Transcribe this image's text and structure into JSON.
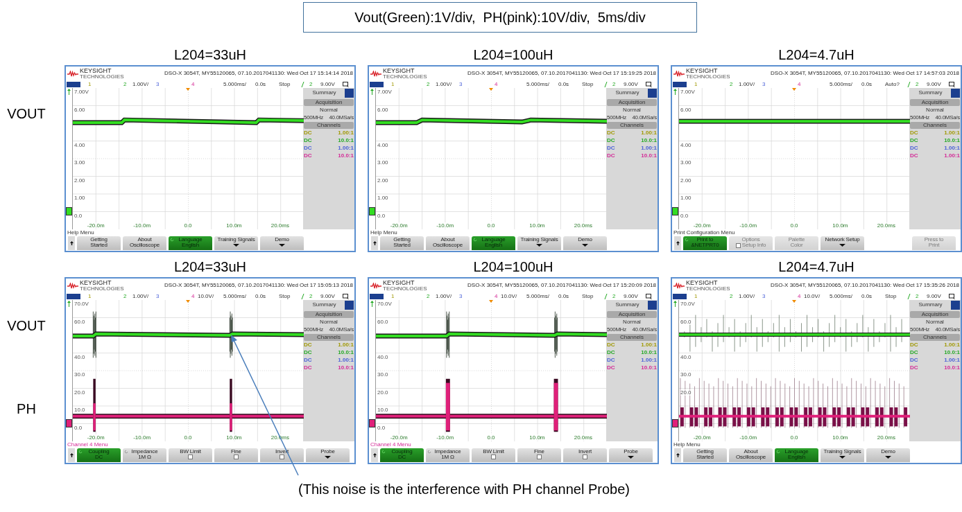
{
  "header": "Vout(Green):1V/div,  PH(pink):10V/div,  5ms/div",
  "rows": [
    {
      "labels": [
        {
          "text": "VOUT",
          "kind": "vout"
        }
      ],
      "panels": [
        {
          "title": "L204=33uH",
          "scope": {
            "brand": "KEYSIGHT",
            "brand_sub": "TECHNOLOGIES",
            "info": "DSO-X 3054T, MY55120065, 07.10.2017041130: Wed Oct 17 15:14:14 2018",
            "status": {
              "ch1": "1",
              "ch2": "2",
              "ch2_scale": "1.00V/",
              "ch3": "3",
              "ch4": "4",
              "timebase": "5.000ms/",
              "delay": "0.0s",
              "run": "Stop",
              "trig_source": "2",
              "trig_level": "9.00V"
            },
            "y_labels": [
              "7.00V",
              "6.00",
              "4.00",
              "3.00",
              "2.00",
              "1.00",
              "0.0"
            ],
            "x_labels": [
              "-20.0m",
              "-10.0m",
              "0.0",
              "10.0m",
              "20.0ms"
            ],
            "traces": [
              {
                "kind": "steps",
                "color": "#33dd22",
                "ground_marker": true
              }
            ],
            "side": {
              "tab": "Summary",
              "acq": "Acquisition",
              "mode": "Normal",
              "bw": "500MHz",
              "rate": "40.0MSa/s",
              "channels_title": "Channels",
              "channels": [
                {
                  "coupling": "DC",
                  "probe": "1.00:1",
                  "color": "#a09800"
                },
                {
                  "coupling": "DC",
                  "probe": "10.0:1",
                  "color": "#22a822"
                },
                {
                  "coupling": "DC",
                  "probe": "1.00:1",
                  "color": "#4a60d8"
                },
                {
                  "coupling": "DC",
                  "probe": "10.0:1",
                  "color": "#d42896"
                }
              ]
            },
            "menu": {
              "title": "Help Menu",
              "kind": "general"
            },
            "softkeys": [
              {
                "kind": "normal",
                "lines": [
                  "Getting",
                  "Started"
                ]
              },
              {
                "kind": "normal",
                "lines": [
                  "About",
                  "Oscilloscope"
                ]
              },
              {
                "kind": "active",
                "lines": [
                  "Language",
                  "English"
                ],
                "rotary": true
              },
              {
                "kind": "normal",
                "lines": [
                  "Training Signals"
                ],
                "submenu": true
              },
              {
                "kind": "normal",
                "lines": [
                  "Demo"
                ],
                "submenu": true
              }
            ]
          }
        },
        {
          "title": "L204=100uH",
          "scope": {
            "brand": "KEYSIGHT",
            "brand_sub": "TECHNOLOGIES",
            "info": "DSO-X 3054T, MY55120065, 07.10.2017041130: Wed Oct 17 15:19:25 2018",
            "status": {
              "ch1": "1",
              "ch2": "2",
              "ch2_scale": "1.00V/",
              "ch3": "3",
              "ch4": "4",
              "timebase": "5.000ms/",
              "delay": "0.0s",
              "run": "Stop",
              "trig_source": "2",
              "trig_level": "9.00V"
            },
            "y_labels": [
              "7.00V",
              "6.00",
              "4.00",
              "3.00",
              "2.00",
              "1.00",
              "0.0"
            ],
            "x_labels": [
              "-20.0m",
              "-10.0m",
              "0.0",
              "10.0m",
              "20.0ms"
            ],
            "traces": [
              {
                "kind": "ramps",
                "color": "#33dd22",
                "ground_marker": true
              }
            ],
            "side": {
              "tab": "Summary",
              "acq": "Acquisition",
              "mode": "Normal",
              "bw": "500MHz",
              "rate": "40.0MSa/s",
              "channels_title": "Channels",
              "channels": [
                {
                  "coupling": "DC",
                  "probe": "1.00:1",
                  "color": "#a09800"
                },
                {
                  "coupling": "DC",
                  "probe": "10.0:1",
                  "color": "#22a822"
                },
                {
                  "coupling": "DC",
                  "probe": "1.00:1",
                  "color": "#4a60d8"
                },
                {
                  "coupling": "DC",
                  "probe": "10.0:1",
                  "color": "#d42896"
                }
              ]
            },
            "menu": {
              "title": "Help Menu",
              "kind": "general"
            },
            "softkeys": [
              {
                "kind": "normal",
                "lines": [
                  "Getting",
                  "Started"
                ]
              },
              {
                "kind": "normal",
                "lines": [
                  "About",
                  "Oscilloscope"
                ]
              },
              {
                "kind": "active",
                "lines": [
                  "Language",
                  "English"
                ],
                "rotary": true
              },
              {
                "kind": "normal",
                "lines": [
                  "Training Signals"
                ],
                "submenu": true
              },
              {
                "kind": "normal",
                "lines": [
                  "Demo"
                ],
                "submenu": true
              }
            ]
          }
        },
        {
          "title": "L204=4.7uH",
          "scope": {
            "brand": "KEYSIGHT",
            "brand_sub": "TECHNOLOGIES",
            "info": "DSO-X 3054T, MY55120065, 07.10.2017041130: Wed Oct 17 14:57:03 2018",
            "status": {
              "ch1": "1",
              "ch2": "2",
              "ch2_scale": "1.00V/",
              "ch3": "3",
              "ch4": "4",
              "timebase": "5.000ms/",
              "delay": "0.0s",
              "run": "Auto?",
              "trig_source": "2",
              "trig_level": "9.00V"
            },
            "y_labels": [
              "7.00V",
              "6.00",
              "4.00",
              "3.00",
              "2.00",
              "1.00",
              "0.0"
            ],
            "x_labels": [
              "-20.0m",
              "-10.0m",
              "0.0",
              "10.0m",
              "20.0ms"
            ],
            "traces": [
              {
                "kind": "flat",
                "color": "#33dd22",
                "ground_marker": true
              }
            ],
            "side": {
              "tab": "Summary",
              "acq": "Acquisition",
              "mode": "Normal",
              "bw": "500MHz",
              "rate": "40.0MSa/s",
              "channels_title": "Channels",
              "channels": [
                {
                  "coupling": "DC",
                  "probe": "1.00:1",
                  "color": "#a09800"
                },
                {
                  "coupling": "DC",
                  "probe": "10.0:1",
                  "color": "#22a822"
                },
                {
                  "coupling": "DC",
                  "probe": "1.00:1",
                  "color": "#4a60d8"
                },
                {
                  "coupling": "DC",
                  "probe": "1.00:1",
                  "color": "#d42896"
                }
              ]
            },
            "menu": {
              "title": "Print Configuration Menu",
              "kind": "general"
            },
            "softkeys": [
              {
                "kind": "active",
                "lines": [
                  "Print to",
                  "&NETPRT0"
                ],
                "rotary": true
              },
              {
                "kind": "disabled",
                "lines": [
                  "Options"
                ],
                "checkbox": {
                  "checked": false,
                  "label": "Setup Info"
                }
              },
              {
                "kind": "disabled",
                "lines": [
                  "Palette",
                  "Color"
                ]
              },
              {
                "kind": "normal",
                "lines": [
                  "Network Setup"
                ],
                "submenu": true
              },
              {
                "kind": "empty"
              },
              {
                "kind": "disabled",
                "lines": [
                  "Press to",
                  "Print"
                ]
              }
            ]
          }
        }
      ]
    },
    {
      "labels": [
        {
          "text": "VOUT",
          "kind": "vout"
        },
        {
          "text": "PH",
          "kind": "ph"
        }
      ],
      "panels": [
        {
          "title": "L204=33uH",
          "scope": {
            "brand": "KEYSIGHT",
            "brand_sub": "TECHNOLOGIES",
            "info": "DSO-X 3054T, MY55120065, 07.10.2017041130: Wed Oct 17 15:05:13 2018",
            "status": {
              "ch1": "1",
              "ch2": "2",
              "ch2_scale": "1.00V/",
              "ch3": "3",
              "ch4": "4",
              "ch4_scale": "10.0V/",
              "timebase": "5.000ms/",
              "delay": "0.0s",
              "run": "Stop",
              "trig_source": "2",
              "trig_level": "9.00V"
            },
            "y_labels": [
              "70.0V",
              "60.0",
              "40.0",
              "30.0",
              "20.0",
              "10.0",
              "0.0"
            ],
            "x_labels": [
              "-20.0m",
              "-10.0m",
              "0.0",
              "10.0m",
              "20.0ms"
            ],
            "traces": [
              {
                "kind": "bursts_wide",
                "color": "#33dd22",
                "ground_marker": false
              },
              {
                "kind": "pulses_wide",
                "color": "#e0207a",
                "ground_marker": true
              }
            ],
            "side": {
              "tab": "Summary",
              "acq": "Acquisition",
              "mode": "Normal",
              "bw": "500MHz",
              "rate": "40.0MSa/s",
              "channels_title": "Channels",
              "channels": [
                {
                  "coupling": "DC",
                  "probe": "1.00:1",
                  "color": "#a09800"
                },
                {
                  "coupling": "DC",
                  "probe": "10.0:1",
                  "color": "#22a822"
                },
                {
                  "coupling": "DC",
                  "probe": "1.00:1",
                  "color": "#4a60d8"
                },
                {
                  "coupling": "DC",
                  "probe": "10.0:1",
                  "color": "#d42896"
                }
              ]
            },
            "menu": {
              "title": "Channel 4 Menu",
              "kind": "channel"
            },
            "softkeys": [
              {
                "kind": "active",
                "lines": [
                  "Coupling",
                  "DC"
                ],
                "rotary": true
              },
              {
                "kind": "normal",
                "lines": [
                  "Impedance",
                  "1M Ω"
                ],
                "rotary": true
              },
              {
                "kind": "normal",
                "lines": [
                  "BW Limit"
                ],
                "checkbox": {
                  "checked": false
                }
              },
              {
                "kind": "normal",
                "lines": [
                  "Fine"
                ],
                "checkbox": {
                  "checked": false
                }
              },
              {
                "kind": "normal",
                "lines": [
                  "Invert"
                ],
                "checkbox": {
                  "checked": false
                }
              },
              {
                "kind": "normal",
                "lines": [
                  "Probe"
                ],
                "submenu": true
              }
            ]
          }
        },
        {
          "title": "L204=100uH",
          "scope": {
            "brand": "KEYSIGHT",
            "brand_sub": "TECHNOLOGIES",
            "info": "DSO-X 3054T, MY55120065, 07.10.2017041130: Wed Oct 17 15:20:09 2018",
            "status": {
              "ch1": "1",
              "ch2": "2",
              "ch2_scale": "1.00V/",
              "ch3": "3",
              "ch4": "4",
              "ch4_scale": "10.0V/",
              "timebase": "5.000ms/",
              "delay": "0.0s",
              "run": "Stop",
              "trig_source": "2",
              "trig_level": "9.00V"
            },
            "y_labels": [
              "70.0V",
              "60.0",
              "40.0",
              "30.0",
              "20.0",
              "10.0",
              "0.0"
            ],
            "x_labels": [
              "-20.0m",
              "-10.0m",
              "0.0",
              "10.0m",
              "20.0ms"
            ],
            "traces": [
              {
                "kind": "bursts_narrow",
                "color": "#33dd22",
                "ground_marker": false
              },
              {
                "kind": "pulses_narrow",
                "color": "#e0207a",
                "ground_marker": true
              }
            ],
            "side": {
              "tab": "Summary",
              "acq": "Acquisition",
              "mode": "Normal",
              "bw": "500MHz",
              "rate": "40.0MSa/s",
              "channels_title": "Channels",
              "channels": [
                {
                  "coupling": "DC",
                  "probe": "1.00:1",
                  "color": "#a09800"
                },
                {
                  "coupling": "DC",
                  "probe": "10.0:1",
                  "color": "#22a822"
                },
                {
                  "coupling": "DC",
                  "probe": "1.00:1",
                  "color": "#4a60d8"
                },
                {
                  "coupling": "DC",
                  "probe": "10.0:1",
                  "color": "#d42896"
                }
              ]
            },
            "menu": {
              "title": "Channel 4 Menu",
              "kind": "channel"
            },
            "softkeys": [
              {
                "kind": "active",
                "lines": [
                  "Coupling",
                  "DC"
                ],
                "rotary": true
              },
              {
                "kind": "normal",
                "lines": [
                  "Impedance",
                  "1M Ω"
                ],
                "rotary": true
              },
              {
                "kind": "normal",
                "lines": [
                  "BW Limit"
                ],
                "checkbox": {
                  "checked": false
                }
              },
              {
                "kind": "normal",
                "lines": [
                  "Fine"
                ],
                "checkbox": {
                  "checked": false
                }
              },
              {
                "kind": "normal",
                "lines": [
                  "Invert"
                ],
                "checkbox": {
                  "checked": false
                }
              },
              {
                "kind": "normal",
                "lines": [
                  "Probe"
                ],
                "submenu": true
              }
            ]
          }
        },
        {
          "title": "L204=4.7uH",
          "scope": {
            "brand": "KEYSIGHT",
            "brand_sub": "TECHNOLOGIES",
            "info": "DSO-X 3054T, MY55120065, 07.10.2017041130: Wed Oct 17 15:35:26 2018",
            "status": {
              "ch1": "1",
              "ch2": "2",
              "ch2_scale": "1.00V/",
              "ch3": "3",
              "ch4": "4",
              "ch4_scale": "10.0V/",
              "timebase": "5.000ms/",
              "delay": "0.0s",
              "run": "Stop",
              "trig_source": "2",
              "trig_level": "9.00V"
            },
            "y_labels": [
              "70.0V",
              "60.0",
              "40.0",
              "30.0",
              "20.0"
            ],
            "x_labels": [
              "-20.0m",
              "-10.0m",
              "0.0",
              "10.0m",
              "20.0ms"
            ],
            "traces": [
              {
                "kind": "spikes",
                "color": "#33dd22",
                "ground_marker": false
              },
              {
                "kind": "pulses_dense",
                "color": "#e0207a",
                "ground_marker": true
              }
            ],
            "side": {
              "tab": "Summary",
              "acq": "Acquisition",
              "mode": "Normal",
              "bw": "500MHz",
              "rate": "40.0MSa/s",
              "channels_title": "Channels",
              "channels": [
                {
                  "coupling": "DC",
                  "probe": "1.00:1",
                  "color": "#a09800"
                },
                {
                  "coupling": "DC",
                  "probe": "10.0:1",
                  "color": "#22a822"
                },
                {
                  "coupling": "DC",
                  "probe": "1.00:1",
                  "color": "#4a60d8"
                },
                {
                  "coupling": "DC",
                  "probe": "10.0:1",
                  "color": "#d42896"
                }
              ]
            },
            "menu": {
              "title": "Help Menu",
              "kind": "general"
            },
            "softkeys": [
              {
                "kind": "normal",
                "lines": [
                  "Getting",
                  "Started"
                ]
              },
              {
                "kind": "normal",
                "lines": [
                  "About",
                  "Oscilloscope"
                ]
              },
              {
                "kind": "active",
                "lines": [
                  "Language",
                  "English"
                ],
                "rotary": true
              },
              {
                "kind": "normal",
                "lines": [
                  "Training Signals"
                ],
                "submenu": true
              },
              {
                "kind": "normal",
                "lines": [
                  "Demo"
                ],
                "submenu": true
              }
            ]
          }
        }
      ]
    }
  ],
  "annotation": "(This noise is the interference with PH channel Probe)"
}
